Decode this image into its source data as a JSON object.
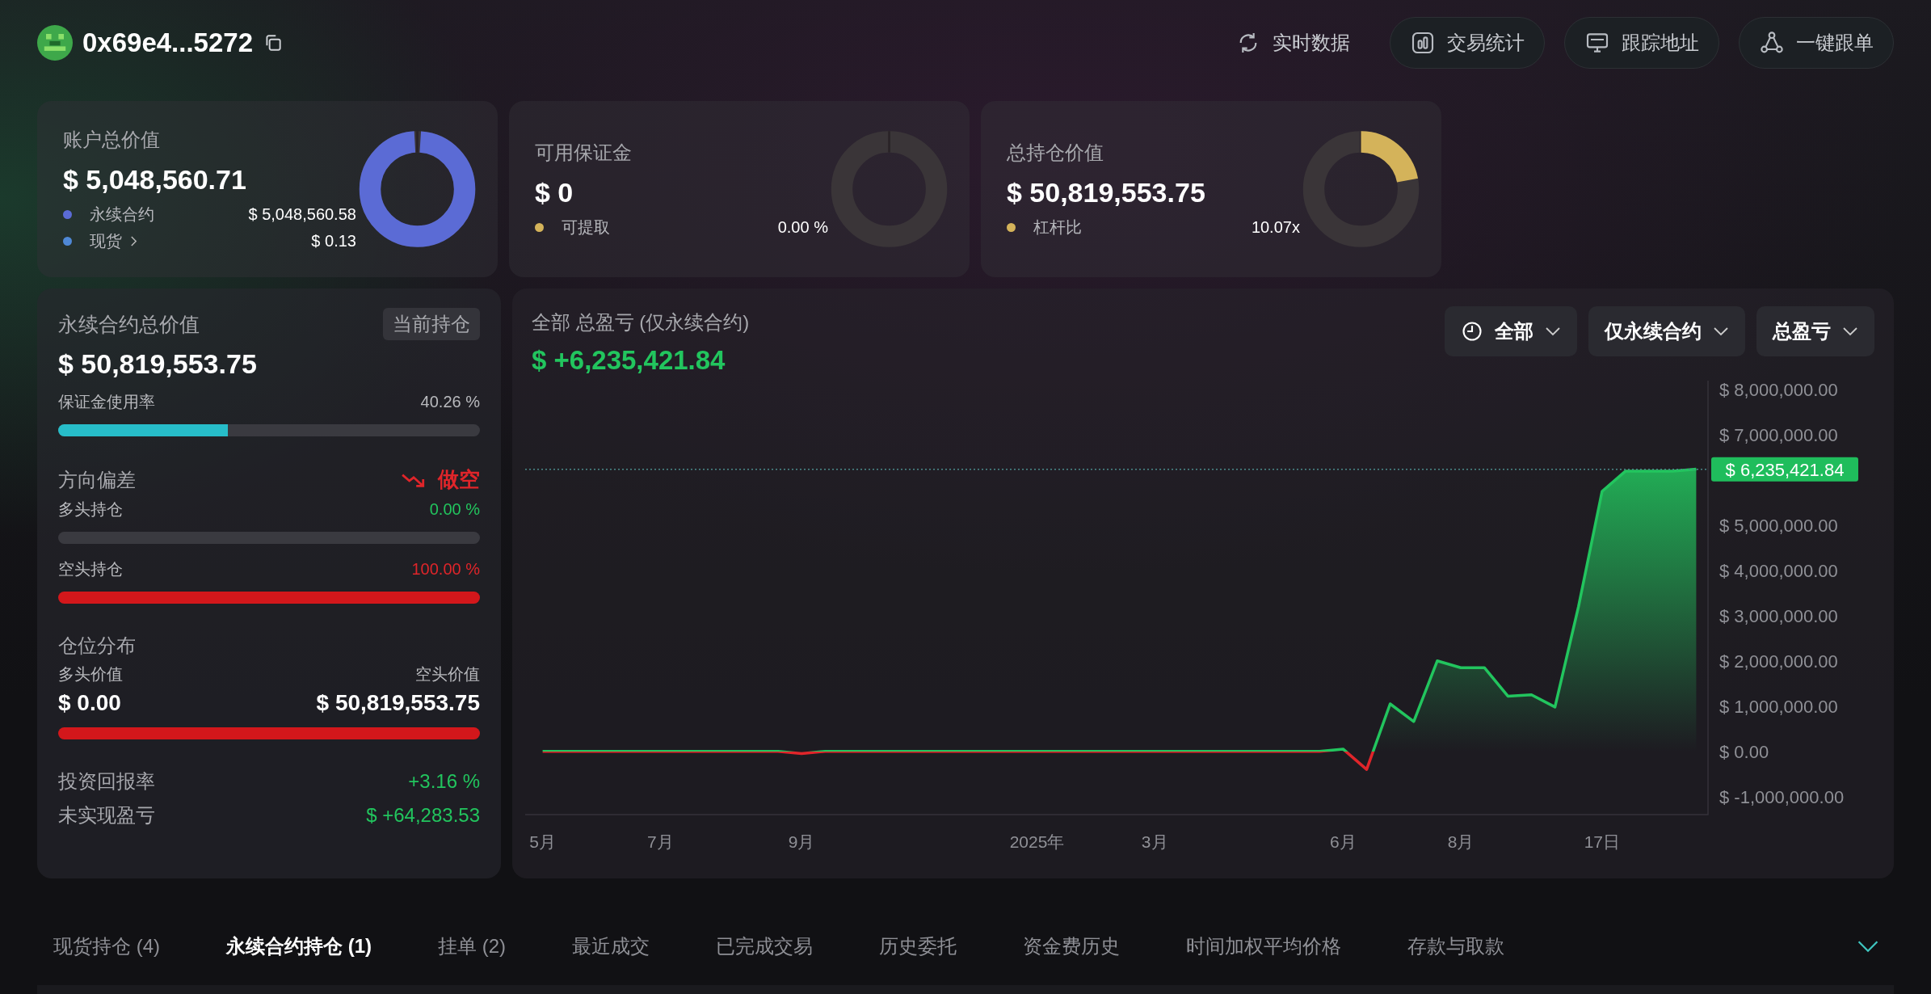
{
  "header": {
    "address": "0x69e4...5272",
    "buttons": [
      {
        "label": "实时数据",
        "outlined": false
      },
      {
        "label": "交易统计",
        "outlined": true
      },
      {
        "label": "跟踪地址",
        "outlined": true
      },
      {
        "label": "一键跟单",
        "outlined": true
      }
    ]
  },
  "summary_cards": [
    {
      "title": "账户总价值",
      "value": "$ 5,048,560.71",
      "level": 1,
      "legend": [
        {
          "label": "永续合约",
          "value": "$ 5,048,560.58",
          "color": "#5b6bd5",
          "link": false
        },
        {
          "label": "现货",
          "value": "$ 0.13",
          "color": "#4f88d6",
          "link": true
        }
      ]
    },
    {
      "title": "可用保证金",
      "value": "$ 0",
      "level": 0,
      "legend": [
        {
          "label": "可提取",
          "value": "0.00 %",
          "color": "#d4b35a",
          "link": false
        }
      ]
    },
    {
      "title": "总持仓价值",
      "value": "$ 50,819,553.75",
      "level": 0.22,
      "legend": [
        {
          "label": "杠杆比",
          "value": "10.07x",
          "color": "#d4b35a",
          "link": false
        }
      ]
    }
  ],
  "perp_panel": {
    "title": "永续合约总价值",
    "badge": "当前持仓",
    "value": "$ 50,819,553.75",
    "margin": {
      "label": "保证金使用率",
      "reading": "40.26 %",
      "level": 0.4026
    },
    "direction": {
      "label": "方向偏差",
      "bias": "做空"
    },
    "long": {
      "label": "多头持仓",
      "reading": "0.00 %",
      "level": 0
    },
    "short": {
      "label": "空头持仓",
      "reading": "100.00 %",
      "level": 1
    },
    "distribution": {
      "label": "仓位分布",
      "long_label": "多头价值",
      "short_label": "空头价值",
      "long_value": "$ 0.00",
      "short_value": "$ 50,819,553.75",
      "level": 0
    },
    "roi": {
      "label": "投资回报率",
      "value": "+3.16 %"
    },
    "unrealized": {
      "label": "未实现盈亏",
      "value": "$ +64,283.53"
    }
  },
  "pnl_panel": {
    "title": "全部 总盈亏 (仅永续合约)",
    "value": "$ +6,235,421.84",
    "filters": [
      {
        "label": "全部"
      },
      {
        "label": "仅永续合约"
      },
      {
        "label": "总盈亏"
      }
    ],
    "current_label": "$ 6,235,421.84",
    "chart_data": {
      "type": "area",
      "categories": [
        "5月",
        null,
        null,
        null,
        null,
        "7月",
        null,
        null,
        null,
        null,
        null,
        "9月",
        null,
        null,
        null,
        null,
        null,
        null,
        null,
        null,
        null,
        "2025年",
        null,
        null,
        null,
        null,
        "3月",
        null,
        null,
        null,
        null,
        null,
        null,
        null,
        "6月",
        null,
        null,
        null,
        null,
        "8月",
        null,
        null,
        null,
        null,
        null,
        "17日",
        null,
        null,
        null,
        null
      ],
      "series": [
        {
          "color": "#22c55e",
          "values": [
            0,
            0,
            0,
            0,
            0,
            0,
            0,
            0,
            0,
            0,
            0,
            -50000,
            0,
            0,
            0,
            0,
            0,
            0,
            0,
            0,
            0,
            0,
            0,
            0,
            0,
            0,
            0,
            0,
            0,
            0,
            0,
            0,
            0,
            0,
            50000,
            -400000,
            1050000,
            660000,
            2000000,
            1850000,
            1850000,
            1220000,
            1250000,
            980000,
            3200000,
            5750000,
            6200000,
            6200000,
            6200000,
            6240000
          ]
        }
      ],
      "ylim": [
        -1400000,
        8200000
      ],
      "ref_lines": [
        {
          "axis": "y",
          "value": 6240000
        }
      ],
      "yticks": [
        {
          "value": 8000000,
          "label": "$ 8,000,000.00"
        },
        {
          "value": 7000000,
          "label": "$ 7,000,000.00"
        },
        {
          "value": 5000000,
          "label": "$ 5,000,000.00"
        },
        {
          "value": 4000000,
          "label": "$ 4,000,000.00"
        },
        {
          "value": 3000000,
          "label": "$ 3,000,000.00"
        },
        {
          "value": 2000000,
          "label": "$ 2,000,000.00"
        },
        {
          "value": 1000000,
          "label": "$ 1,000,000.00"
        },
        {
          "value": 0,
          "label": "$ 0.00"
        },
        {
          "value": -1000000,
          "label": "$ -1,000,000.00"
        }
      ]
    }
  },
  "tabs": [
    {
      "label": "现货持仓 (4)",
      "selected": false
    },
    {
      "label": "永续合约持仓 (1)",
      "selected": true
    },
    {
      "label": "挂单 (2)",
      "selected": false
    },
    {
      "label": "最近成交",
      "selected": false
    },
    {
      "label": "已完成交易",
      "selected": false
    },
    {
      "label": "历史委托",
      "selected": false
    },
    {
      "label": "资金费历史",
      "selected": false
    },
    {
      "label": "时间加权平均价格",
      "selected": false
    },
    {
      "label": "存款与取款",
      "selected": false
    }
  ]
}
